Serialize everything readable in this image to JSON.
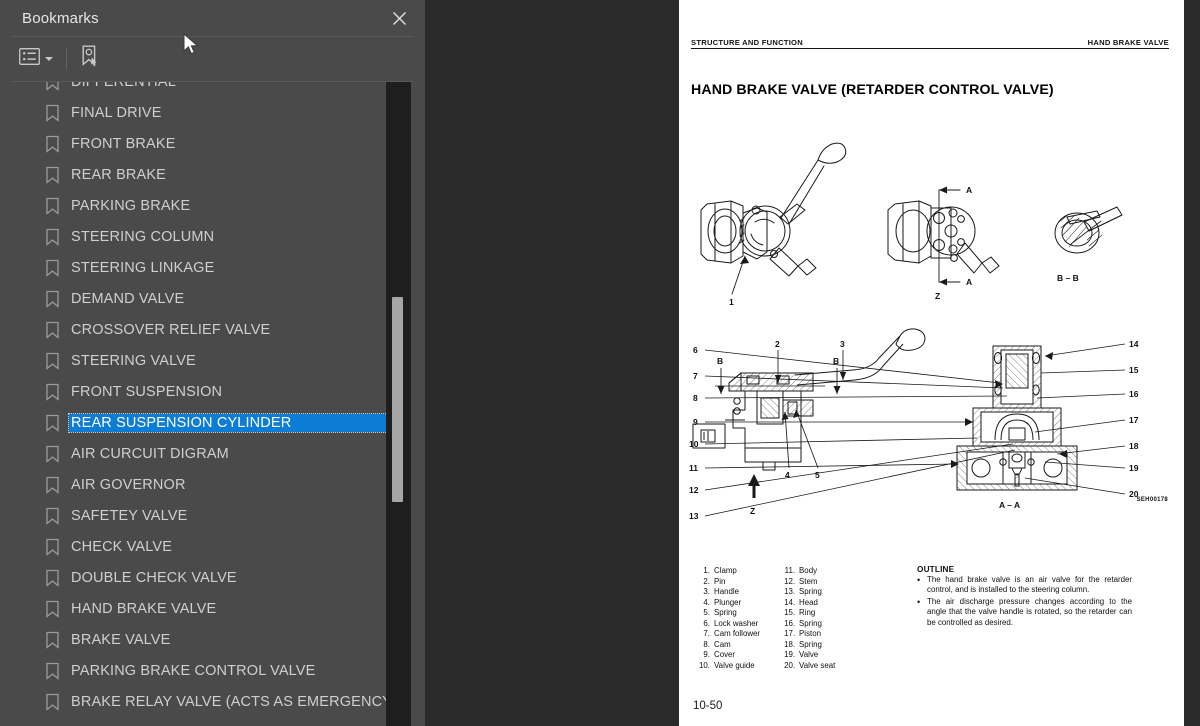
{
  "panel": {
    "title": "Bookmarks",
    "close_icon": "close-icon",
    "toolbar": {
      "options_icon": "list-options-icon",
      "options_caret": "chevron-down-icon",
      "new_bookmark_icon": "new-bookmark-icon"
    },
    "collapse_icon": "chevron-left-icon",
    "selected_index": 11,
    "items": [
      {
        "label": "DIFFERENTIAL"
      },
      {
        "label": "FINAL DRIVE"
      },
      {
        "label": "FRONT BRAKE"
      },
      {
        "label": "REAR BRAKE"
      },
      {
        "label": "PARKING BRAKE"
      },
      {
        "label": "STEERING COLUMN"
      },
      {
        "label": "STEERING LINKAGE"
      },
      {
        "label": "DEMAND VALVE"
      },
      {
        "label": "CROSSOVER RELIEF VALVE"
      },
      {
        "label": "STEERING VALVE"
      },
      {
        "label": "FRONT SUSPENSION"
      },
      {
        "label": "REAR SUSPENSION CYLINDER"
      },
      {
        "label": "AIR CURCUIT DIGRAM"
      },
      {
        "label": "AIR GOVERNOR"
      },
      {
        "label": "SAFETEY VALVE"
      },
      {
        "label": "CHECK VALVE"
      },
      {
        "label": "DOUBLE CHECK VALVE"
      },
      {
        "label": "HAND BRAKE VALVE"
      },
      {
        "label": "BRAKE VALVE"
      },
      {
        "label": "PARKING BRAKE CONTROL VALVE"
      },
      {
        "label": "BRAKE RELAY VALVE (ACTS AS EMERGENCY RELAY)"
      }
    ]
  },
  "colors": {
    "panel_bg": "#4a4a4a",
    "viewer_bg": "#2b2b2b",
    "selection_blue": "#0c7cd5",
    "scroll_track": "#1e1e1e",
    "scroll_thumb": "#a6a6a6",
    "text": "#cfcfcf"
  },
  "document": {
    "header_left": "STRUCTURE AND FUNCTION",
    "header_right": "HAND BRAKE VALVE",
    "title": "HAND BRAKE VALVE  (RETARDER CONTROL VALVE)",
    "page_number": "10-50",
    "figure_code": "SEH00178",
    "figure_labels": {
      "top": [
        "1",
        "A",
        "A",
        "Z",
        "B – B"
      ],
      "bottom_left": [
        "2",
        "3",
        "4",
        "5",
        "B",
        "B",
        "Z"
      ],
      "bottom_right": [
        "6",
        "7",
        "8",
        "9",
        "10",
        "11",
        "12",
        "13",
        "14",
        "15",
        "16",
        "17",
        "18",
        "19",
        "20",
        "A – A"
      ]
    },
    "parts_col1": [
      {
        "n": "1.",
        "name": "Clamp"
      },
      {
        "n": "2.",
        "name": "Pin"
      },
      {
        "n": "3.",
        "name": "Handle"
      },
      {
        "n": "4.",
        "name": "Plunger"
      },
      {
        "n": "5.",
        "name": "Spring"
      },
      {
        "n": "6.",
        "name": "Lock washer"
      },
      {
        "n": "7.",
        "name": "Cam follower"
      },
      {
        "n": "8.",
        "name": "Cam"
      },
      {
        "n": "9.",
        "name": "Cover"
      },
      {
        "n": "10.",
        "name": "Valve guide"
      }
    ],
    "parts_col2": [
      {
        "n": "11.",
        "name": "Body"
      },
      {
        "n": "12.",
        "name": "Stem"
      },
      {
        "n": "13.",
        "name": "Spring"
      },
      {
        "n": "14.",
        "name": "Head"
      },
      {
        "n": "15.",
        "name": "Ring"
      },
      {
        "n": "16.",
        "name": "Spring"
      },
      {
        "n": "17.",
        "name": "Piston"
      },
      {
        "n": "18.",
        "name": "Spring"
      },
      {
        "n": "19.",
        "name": "Valve"
      },
      {
        "n": "20.",
        "name": "Valve seat"
      }
    ],
    "outline_heading": "OUTLINE",
    "outline_bullets": [
      "The hand brake valve is an air valve for the retarder control, and is installed to the steering column.",
      "The air discharge pressure changes according to the angle that the valve handle is rotated, so the retarder can be controlled as desired."
    ]
  }
}
